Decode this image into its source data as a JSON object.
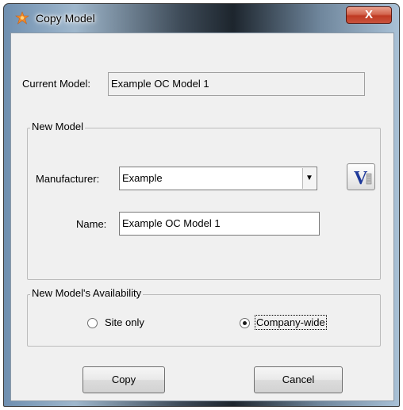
{
  "window": {
    "title": "Copy Model",
    "close_glyph": "X"
  },
  "current_model": {
    "label": "Current Model:",
    "value": "Example OC Model 1"
  },
  "new_model": {
    "group_title": "New Model",
    "manufacturer_label": "Manufacturer:",
    "manufacturer_value": "Example",
    "name_label": "Name:",
    "name_value": "Example OC Model 1",
    "view_button_icon": "v-logo-icon"
  },
  "availability": {
    "group_title": "New Model's Availability",
    "options": [
      {
        "label": "Site only",
        "selected": false
      },
      {
        "label": "Company-wide",
        "selected": true
      }
    ]
  },
  "buttons": {
    "copy_label": "Copy",
    "cancel_label": "Cancel"
  },
  "colors": {
    "app_icon": "#f08a2a",
    "v_logo": "#1f3a9a"
  }
}
